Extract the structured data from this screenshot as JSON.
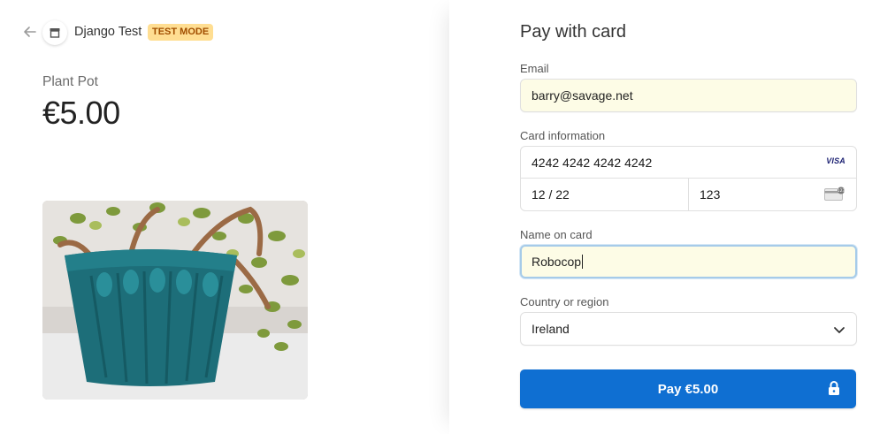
{
  "header": {
    "back_icon": "arrow-left-icon",
    "store_icon": "storefront-icon",
    "store_name": "Django Test",
    "test_badge": "TEST MODE"
  },
  "product": {
    "name": "Plant Pot",
    "price": "€5.00",
    "image": "teal knitted cozy on a plant pot with a jade plant"
  },
  "payment": {
    "title": "Pay with card",
    "email": {
      "label": "Email",
      "value": "barry@savage.net"
    },
    "card": {
      "label": "Card information",
      "number": "4242 4242 4242 4242",
      "brand": "VISA",
      "expiry": "12 / 22",
      "cvc": "123"
    },
    "name": {
      "label": "Name on card",
      "value": "Robocop"
    },
    "country": {
      "label": "Country or region",
      "value": "Ireland"
    },
    "pay_button": "Pay €5.00"
  },
  "colors": {
    "accent": "#0f6fd2",
    "autofill": "#fdfce6",
    "badge_bg": "#ffde92",
    "badge_text": "#a14e00"
  }
}
